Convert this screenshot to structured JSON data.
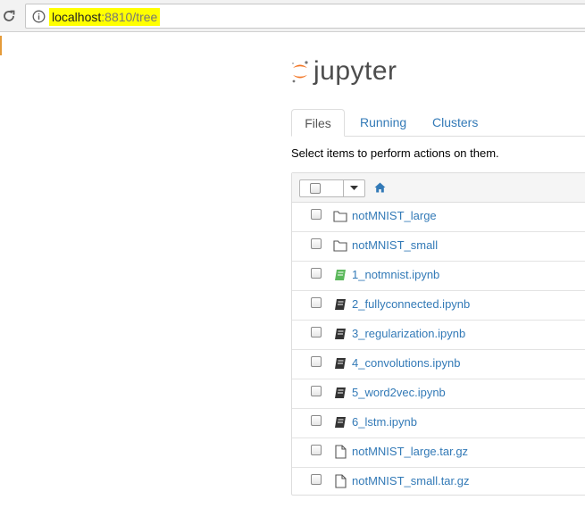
{
  "browser": {
    "url_host": "localhost",
    "url_rest": ":8810/tree",
    "url_highlight_color": "#ffff00"
  },
  "header": {
    "logo_text": "jupyter",
    "logo_color": "#f37726"
  },
  "tabs": [
    {
      "label": "Files",
      "active": true
    },
    {
      "label": "Running",
      "active": false
    },
    {
      "label": "Clusters",
      "active": false
    }
  ],
  "hint": "Select items to perform actions on them.",
  "files": [
    {
      "name": "notMNIST_large",
      "icon": "folder-icon"
    },
    {
      "name": "notMNIST_small",
      "icon": "folder-icon"
    },
    {
      "name": "1_notmnist.ipynb",
      "icon": "notebook-running-icon"
    },
    {
      "name": "2_fullyconnected.ipynb",
      "icon": "notebook-icon"
    },
    {
      "name": "3_regularization.ipynb",
      "icon": "notebook-icon"
    },
    {
      "name": "4_convolutions.ipynb",
      "icon": "notebook-icon"
    },
    {
      "name": "5_word2vec.ipynb",
      "icon": "notebook-icon"
    },
    {
      "name": "6_lstm.ipynb",
      "icon": "notebook-icon"
    },
    {
      "name": "notMNIST_large.tar.gz",
      "icon": "file-icon"
    },
    {
      "name": "notMNIST_small.tar.gz",
      "icon": "file-icon"
    }
  ],
  "colors": {
    "link": "#337ab7",
    "notebook_running": "#5cb85c",
    "notebook": "#333333"
  }
}
